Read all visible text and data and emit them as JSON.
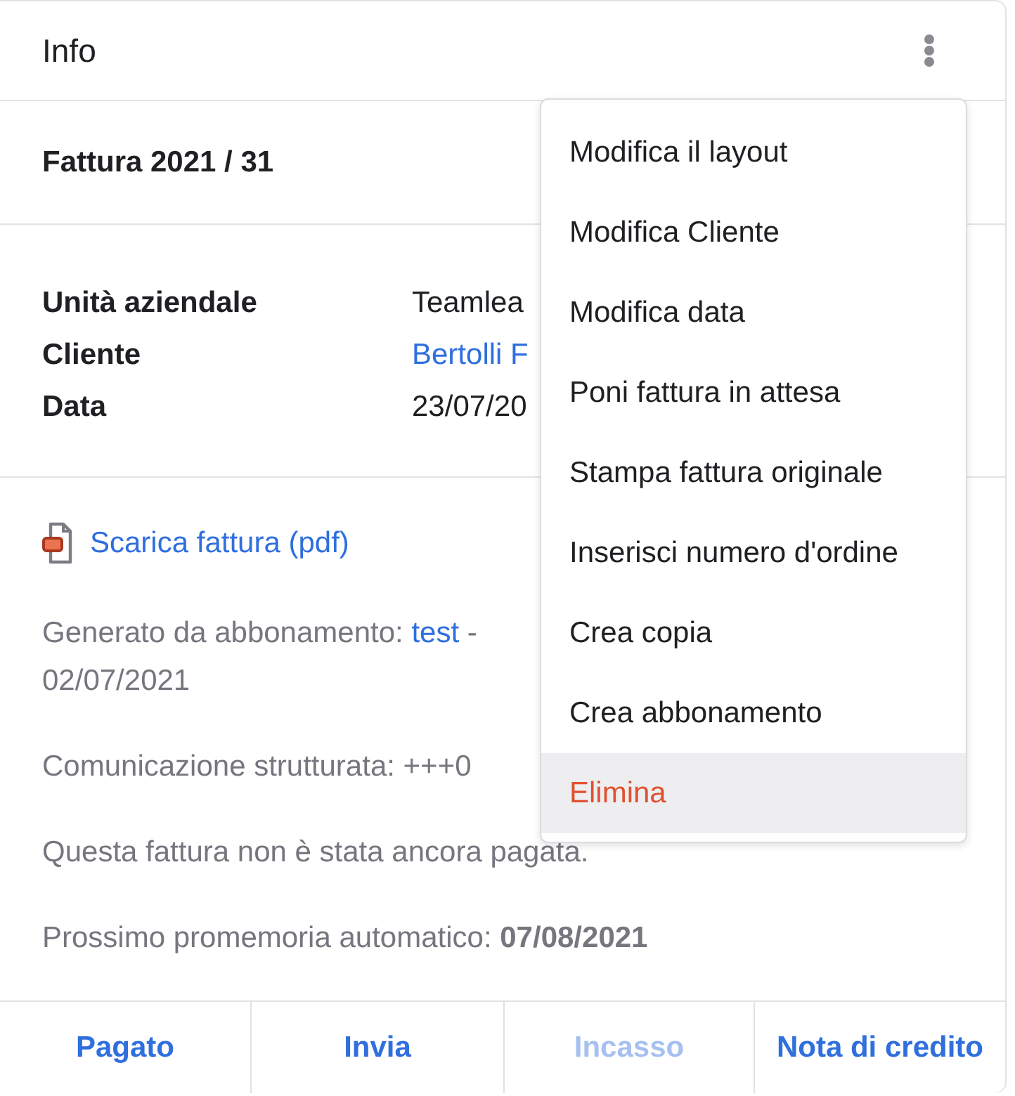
{
  "panel": {
    "title": "Info"
  },
  "invoice": {
    "title": "Fattura 2021 / 31"
  },
  "details": [
    {
      "label": "Unità aziendale",
      "value": "Teamlea",
      "kind": "text"
    },
    {
      "label": "Cliente",
      "value": "Bertolli F",
      "kind": "link"
    },
    {
      "label": "Data",
      "value": "23/07/20",
      "kind": "text"
    }
  ],
  "download": {
    "label": "Scarica fattura (pdf)"
  },
  "notes": [
    {
      "kind": "subscription",
      "text": "Generato da abbonamento:",
      "link": "test",
      "after": "-",
      "continuation": "02/07/2021"
    },
    {
      "kind": "text",
      "text": "Comunicazione strutturata: +++0"
    },
    {
      "kind": "text",
      "text": "Questa fattura non è stata ancora pagata."
    },
    {
      "kind": "text",
      "text": "Prossimo promemoria automatico: **07/08/2021**"
    }
  ],
  "menu": {
    "items": [
      {
        "label": "Modifica il layout",
        "kind": "normal",
        "selected": false
      },
      {
        "label": "Modifica Cliente",
        "kind": "normal",
        "selected": false
      },
      {
        "label": "Modifica data",
        "kind": "normal",
        "selected": false
      },
      {
        "label": "Poni fattura in attesa",
        "kind": "normal",
        "selected": false
      },
      {
        "label": "Stampa fattura originale",
        "kind": "normal",
        "selected": false
      },
      {
        "label": "Inserisci numero d'ordine",
        "kind": "normal",
        "selected": false
      },
      {
        "label": "Crea copia",
        "kind": "normal",
        "selected": false
      },
      {
        "label": "Crea abbonamento",
        "kind": "normal",
        "selected": false
      },
      {
        "label": "Elimina",
        "kind": "danger",
        "selected": true
      }
    ]
  },
  "actions": [
    {
      "label": "Pagato",
      "disabled": false
    },
    {
      "label": "Invia",
      "disabled": false
    },
    {
      "label": "Incasso",
      "disabled": true
    },
    {
      "label": "Nota di credito",
      "disabled": false
    }
  ]
}
